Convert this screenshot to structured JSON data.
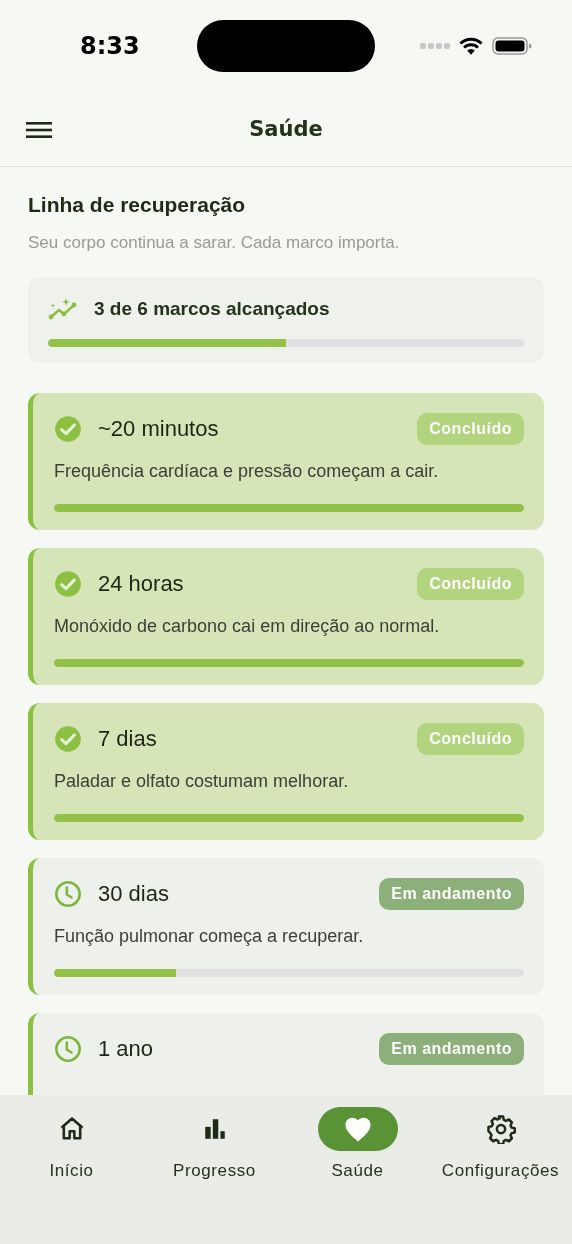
{
  "status_bar": {
    "time": "8:33"
  },
  "header": {
    "title": "Saúde"
  },
  "intro": {
    "title": "Linha de recuperação",
    "subtitle": "Seu corpo continua a sarar. Cada marco importa."
  },
  "summary": {
    "text": "3 de 6 marcos alcançados",
    "level": 0.5
  },
  "milestones": [
    {
      "title": "~20 minutos",
      "status": "Concluído",
      "kind": "done",
      "description": "Frequência cardíaca e pressão começam a cair.",
      "level": 1
    },
    {
      "title": "24 horas",
      "status": "Concluído",
      "kind": "done",
      "description": "Monóxido de carbono cai em direção ao normal.",
      "level": 1
    },
    {
      "title": "7 dias",
      "status": "Concluído",
      "kind": "done",
      "description": "Paladar e olfato costumam melhorar.",
      "level": 1
    },
    {
      "title": "30 dias",
      "status": "Em andamento",
      "kind": "in_progress",
      "description": "Função pulmonar começa a recuperar.",
      "level": 0.26
    },
    {
      "title": "1 ano",
      "status": "Em andamento",
      "kind": "in_progress"
    }
  ],
  "nav": [
    {
      "label": "Início",
      "kind": "home",
      "selected": false
    },
    {
      "label": "Progresso",
      "kind": "chart",
      "selected": false
    },
    {
      "label": "Saúde",
      "kind": "heart",
      "selected": true
    },
    {
      "label": "Configurações",
      "kind": "gear",
      "selected": false
    }
  ]
}
